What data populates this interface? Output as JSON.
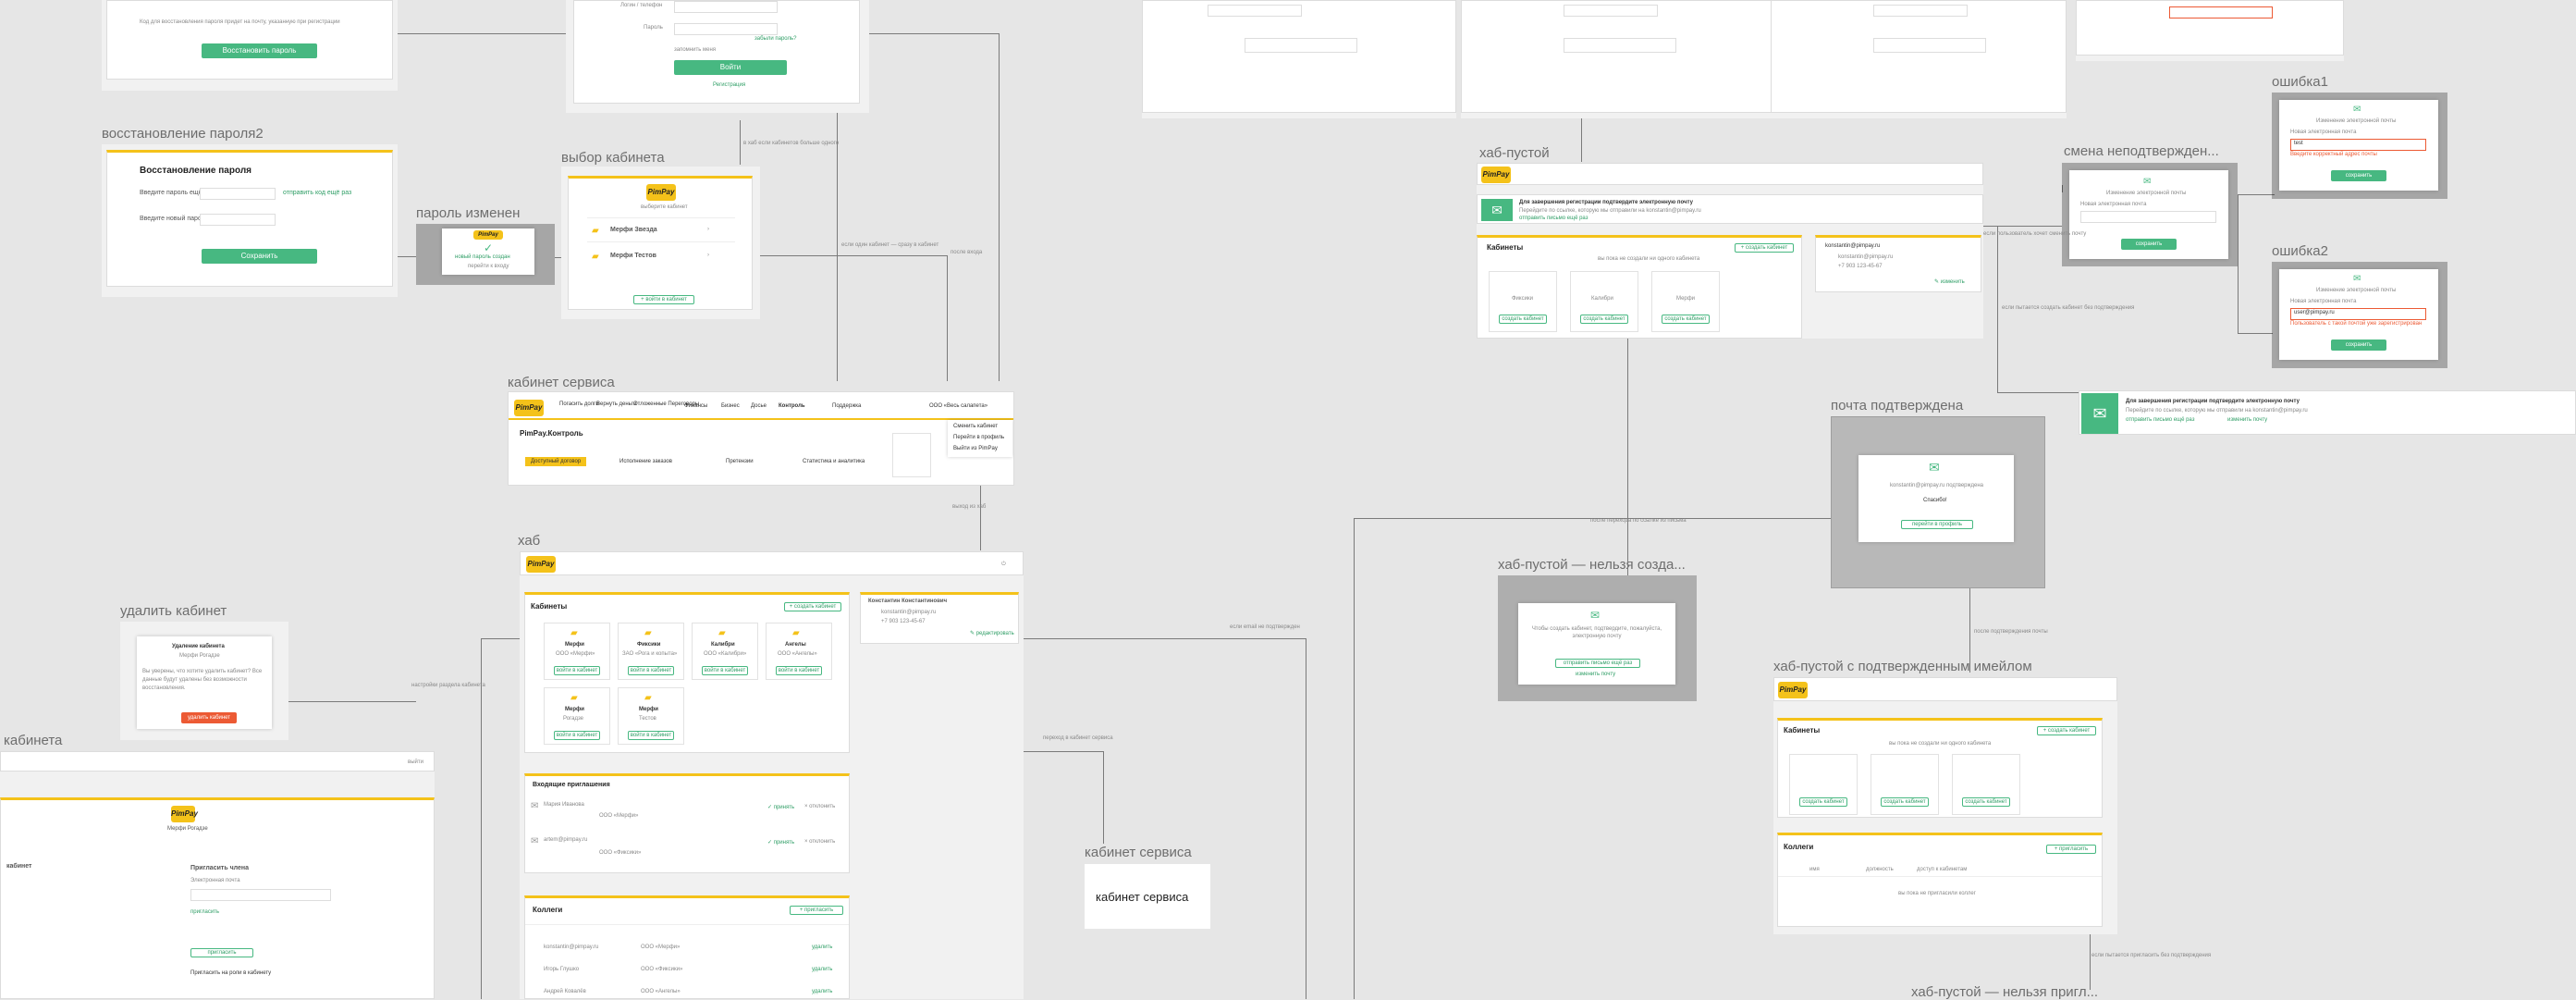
{
  "labels": {
    "restore2": "восстановление пароля2",
    "pw_changed": "пароль изменен",
    "choose_cabinet": "выбор кабинета",
    "service_cabinet": "кабинет сервиса",
    "hub": "хаб",
    "delete_cabinet": "удалить кабинет",
    "cabinet": "кабинета",
    "service_cabinet2": "кабинет сервиса",
    "hub_empty": "хаб-пустой",
    "change_unconfirmed": "смена неподтвержден...",
    "error1": "ошибка1",
    "error2": "ошибка2",
    "email_confirmed": "почта подтверждена",
    "hub_empty_cannot": "хаб-пустой — нельзя созда...",
    "hub_empty_confirmed": "хаб-пустой с подтвержденным имейлом",
    "hub_empty_cannot_invite": "хаб-пустой — нельзя пригл..."
  },
  "brand": {
    "logo": "PimPay",
    "accent": "#f4c21a",
    "green": "#47b881",
    "red": "#ec5a34"
  },
  "restore": {
    "title": "Восстановление пароля",
    "field1": "Введите пароль ещё",
    "field2": "Введите новый пароль",
    "hint": "отправить код ещё раз",
    "save": "Сохранить",
    "top_btn": "Восстановить пароль",
    "top_text": "Код для восстановления пароля придет на почту, указанную при регистрации"
  },
  "login": {
    "field1": "Логин / телефон",
    "field2": "Пароль",
    "forgot": "забыли пароль?",
    "remember": "запомнить меня",
    "enter": "Войти",
    "register": "Регистрация"
  },
  "pw_changed": {
    "text": "новый пароль создан",
    "sub": "перейти к входу"
  },
  "choose": {
    "caption": "выберите кабинет",
    "items": [
      {
        "name": "Мерфи Звезда"
      },
      {
        "name": "Мерфи Тестов"
      }
    ],
    "add": "+ войти в кабинет"
  },
  "service": {
    "nav": [
      "Погасить долги",
      "Вернуть деньги",
      "Отложенные Переговоры",
      "Финансы",
      "Бизнес",
      "Досье",
      "Контроль",
      "Поддержка"
    ],
    "company": "ООО «Весь салапета»",
    "heading": "PimPay.Контроль",
    "tabs": [
      "Доступный договор",
      "Исполнение заказов",
      "Претензии",
      "Статистика и аналитика"
    ],
    "menu": [
      "Сменить кабинет",
      "Перейти в профиль",
      "Выйти из PimPay"
    ],
    "note": "выход из хаб"
  },
  "hub": {
    "cabinets_title": "Кабинеты",
    "create": "+ создать кабинет",
    "cards": [
      {
        "name": "Мерфи",
        "sub": "ООО «Мерфи»"
      },
      {
        "name": "Фиксики",
        "sub": "ЗАО «Рога и копыта»"
      },
      {
        "name": "Калибри",
        "sub": "ООО «Калибри»"
      },
      {
        "name": "Ангелы",
        "sub": "ООО «Ангелы»"
      },
      {
        "name": "Мерфи",
        "sub": "Рогадзе"
      },
      {
        "name": "Мерфи",
        "sub": "Тестов"
      }
    ],
    "enter_btn": "войти в кабинет",
    "profile_name": "Константин Константинович",
    "profile_email": "konstantin@pimpay.ru",
    "profile_phone": "+7 903 123-45-67",
    "edit": "✎ редактировать",
    "invites_title": "Входящие приглашения",
    "invites": [
      {
        "who": "Мария Иванова",
        "org": "ООО «Мерфи»",
        "accept": "✓ принять",
        "reject": "× отклонить"
      },
      {
        "who": "artem@pimpay.ru",
        "org": "ООО «Фиксики»",
        "accept": "✓ принять",
        "reject": "× отклонить"
      }
    ],
    "colleagues_title": "Коллеги",
    "invite_btn": "+ пригласить",
    "colleagues": [
      {
        "email": "konstantin@pimpay.ru",
        "org": "ООО «Мерфи»",
        "action": "удалить"
      },
      {
        "email": "Игорь Глушко",
        "org": "ООО «Фиксики»",
        "action": "удалить"
      },
      {
        "email": "Андрей Ковалёв",
        "org": "ООО «Ангелы»",
        "action": "удалить"
      }
    ]
  },
  "delete": {
    "title": "Удаление кабинета",
    "name": "Мерфи Рогадзе",
    "text": "Вы уверены, что хотите удалить кабинет? Все данные будут удалены без возможности восстановления.",
    "button": "удалить кабинет"
  },
  "cabinet_detail": {
    "name": "Мерфи Рогадзе",
    "left_title": "кабинет",
    "right_title": "Пригласить члена",
    "right_field": "Электронная почта",
    "invite": "пригласить",
    "section2": "Пригласить на роли в кабинету",
    "close": "выйти"
  },
  "service_card": {
    "text": "кабинет сервиса"
  },
  "hub_empty": {
    "banner": "Для завершения регистрации подтвердите электронную почту",
    "banner_sub": "Перейдите по ссылке, которую мы отправили на konstantin@pimpay.ru",
    "resend": "отправить письмо ещё раз",
    "cabinets_title": "Кабинеты",
    "create": "+ создать кабинет",
    "hint": "вы пока не создали ни одного кабинета",
    "slots": [
      "Фиксики",
      "Калибри",
      "Мерфи"
    ],
    "slot_btn": "создать кабинет",
    "profile_email": "konstantin@pimpay.ru",
    "profile_phone": "+7 903 123-45-67",
    "edit": "✎ изменить"
  },
  "change_email": {
    "title": "Изменение электронной почты",
    "field": "Новая электронная почта",
    "button": "сохранить"
  },
  "error1": {
    "title": "Изменение электронной почты",
    "field": "Новая электронная почта",
    "value": "test",
    "error": "Введите корректный адрес почты",
    "button": "сохранить"
  },
  "error2": {
    "title": "Изменение электронной почты",
    "field": "Новая электронная почта",
    "value": "user@pimpay.ru",
    "error": "Пользователь с такой почтой уже зарегистрирован",
    "button": "сохранить"
  },
  "banner_wide": {
    "title": "Для завершения регистрации подтвердите электронную почту",
    "sub": "Перейдите по ссылке, которую мы отправили на konstantin@pimpay.ru",
    "link": "отправить письмо ещё раз",
    "link2": "изменить почту"
  },
  "email_confirmed": {
    "text": "konstantin@pimpay.ru подтверждена",
    "thanks": "Спасибо!",
    "btn": "перейти в профиль"
  },
  "cannot_create": {
    "text": "Чтобы создать кабинет, подтвердите, пожалуйста, электронную почту",
    "btn": "отправить письмо ещё раз",
    "link": "изменить почту"
  },
  "confirmed_hub": {
    "cabinets_title": "Кабинеты",
    "create": "+ создать кабинет",
    "hint": "вы пока не создали ни одного кабинета",
    "slot_btn": "создать кабинет",
    "colleagues_title": "Коллеги",
    "invite": "+ пригласить",
    "cols": [
      "имя",
      "должность",
      "доступ к кабинетам"
    ],
    "empty": "вы пока не пригласили коллег"
  },
  "notes": {
    "n1": "в хаб если кабинетов больше одного",
    "n2": "если один кабинет — сразу в кабинет",
    "n3": "после входа",
    "n4": "выход из хаб",
    "n5": "настройки раздела кабинета",
    "n6": "переход в кабинет сервиса",
    "n7": "если email не подтвержден",
    "n8": "после перехода по ссылке из письма",
    "n9": "если пользователь хочет сменить почту",
    "n10": "если пытается создать кабинет без подтверждения",
    "n11": "после подтверждения почты",
    "n12": "если пытается пригласить без подтверждения"
  }
}
